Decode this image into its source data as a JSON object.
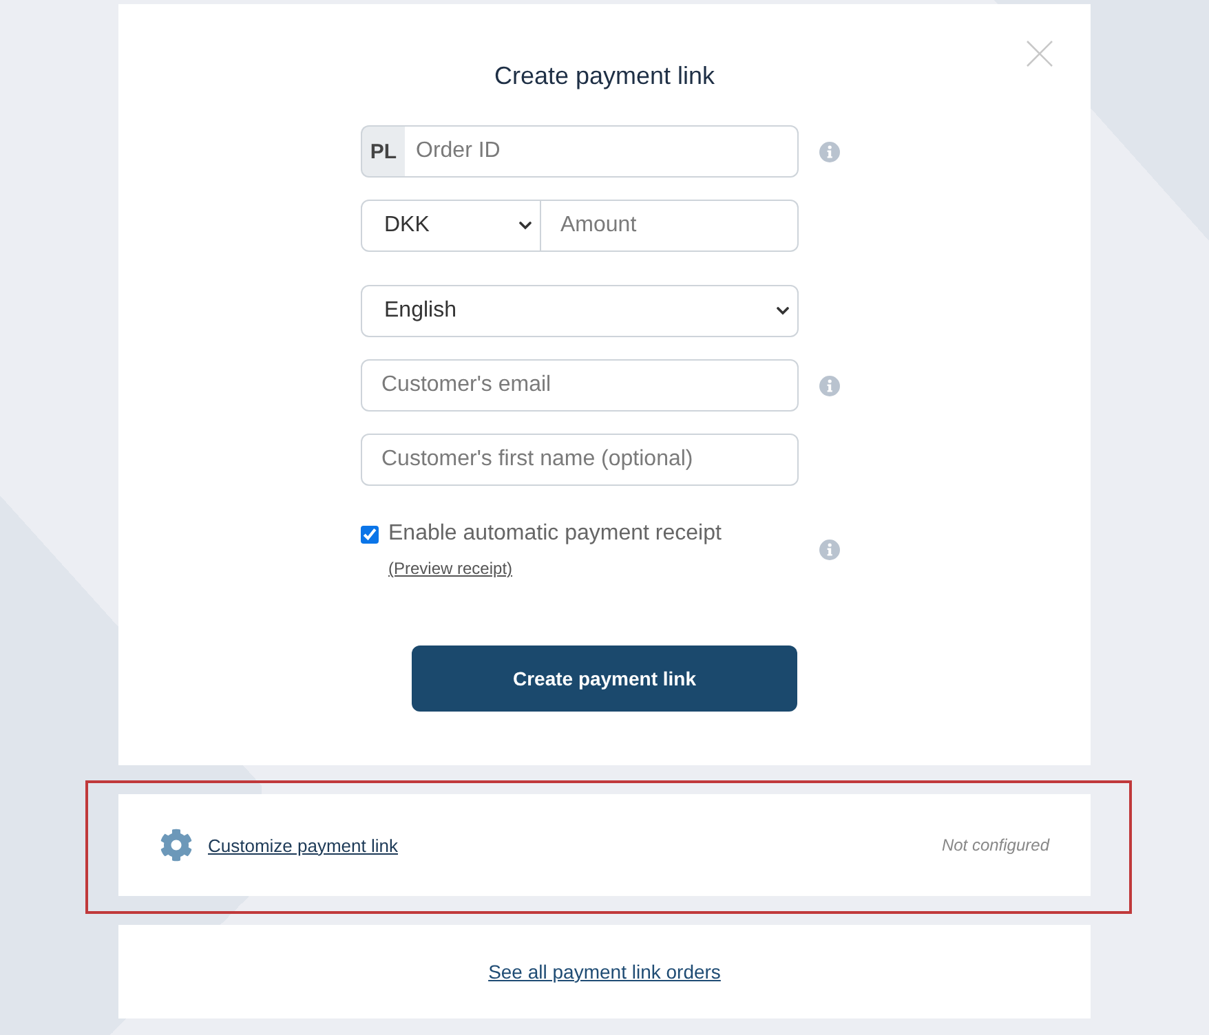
{
  "dialog": {
    "title": "Create payment link",
    "closable": true
  },
  "fields": [
    {
      "kind": "prefixed_input",
      "prefix": "PL",
      "placeholder": "Order ID",
      "info": true
    },
    {
      "kind": "currency_amount",
      "currency": "DKK",
      "placeholder": "Amount",
      "info": false
    },
    {
      "kind": "language_select",
      "value": "English",
      "info": false
    },
    {
      "kind": "input",
      "placeholder": "Customer's email",
      "info": true
    },
    {
      "kind": "input",
      "placeholder": "Customer's first name (optional)",
      "info": false
    }
  ],
  "receipt": {
    "label": "Enable automatic payment receipt",
    "checked": true,
    "link": "(Preview receipt)",
    "info": true
  },
  "submit": {
    "label": "Create payment link"
  },
  "customize": {
    "link": "Customize payment link",
    "status": "Not configured",
    "highlighted": true
  },
  "footer": {
    "link": "See all payment link orders"
  }
}
